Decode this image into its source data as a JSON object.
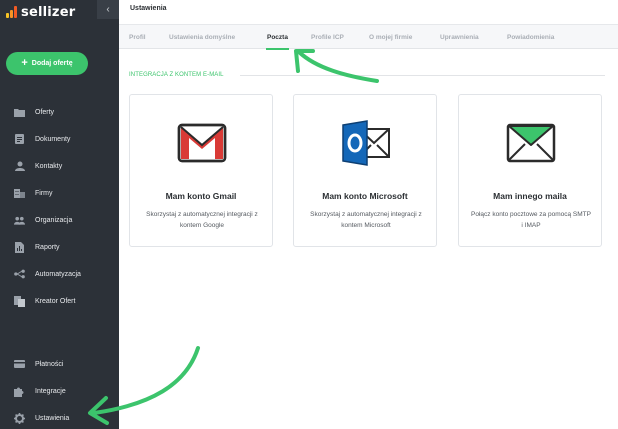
{
  "brand": {
    "name": "sellizer"
  },
  "sidebar": {
    "collapse_glyph": "‹",
    "add_button": {
      "plus": "+",
      "label": "Dodaj ofertę"
    },
    "items": [
      {
        "label": "Oferty",
        "icon": "folder-icon"
      },
      {
        "label": "Dokumenty",
        "icon": "document-icon"
      },
      {
        "label": "Kontakty",
        "icon": "user-icon"
      },
      {
        "label": "Firmy",
        "icon": "building-icon"
      },
      {
        "label": "Organizacja",
        "icon": "people-icon"
      },
      {
        "label": "Raporty",
        "icon": "report-icon"
      },
      {
        "label": "Automatyzacja",
        "icon": "automation-icon"
      },
      {
        "label": "Kreator Ofert",
        "icon": "offer-builder-icon"
      }
    ],
    "bottom_items": [
      {
        "label": "Płatności",
        "icon": "credit-card-icon"
      },
      {
        "label": "Integracje",
        "icon": "puzzle-icon"
      },
      {
        "label": "Ustawienia",
        "icon": "gear-icon"
      }
    ]
  },
  "header": {
    "title": "Ustawienia"
  },
  "tabs": [
    {
      "label": "Profil",
      "active": false
    },
    {
      "label": "Ustawienia domyślne",
      "active": false
    },
    {
      "label": "Poczta",
      "active": true
    },
    {
      "label": "Profile ICP",
      "active": false
    },
    {
      "label": "O mojej firmie",
      "active": false
    },
    {
      "label": "Uprawnienia",
      "active": false
    },
    {
      "label": "Powiadomienia",
      "active": false
    }
  ],
  "main": {
    "section_heading": "INTEGRACJA Z KONTEM E-MAIL",
    "cards": [
      {
        "title": "Mam konto Gmail",
        "desc": "Skorzystaj z automatycznej integracji z kontem Google",
        "icon": "gmail-icon"
      },
      {
        "title": "Mam konto Microsoft",
        "desc": "Skorzystaj z automatycznej integracji z kontem Microsoft",
        "icon": "outlook-icon"
      },
      {
        "title": "Mam innego maila",
        "desc": "Połącz konto pocztowe za pomocą SMTP i IMAP",
        "icon": "envelope-icon"
      }
    ]
  },
  "colors": {
    "accent": "#3cc46c",
    "sidebar": "#2c3138",
    "gmail_red": "#d93a36",
    "outlook_blue": "#1467b8"
  }
}
